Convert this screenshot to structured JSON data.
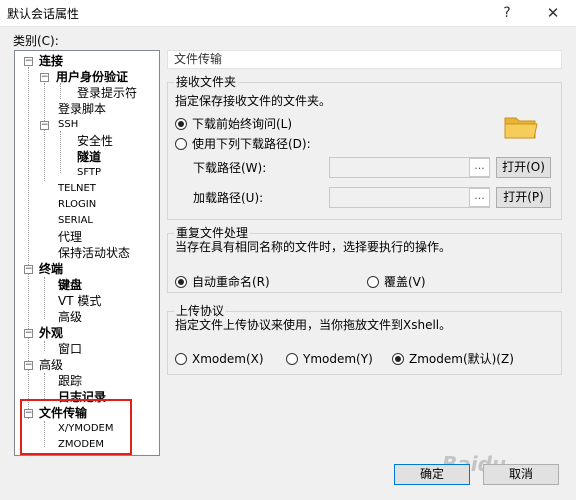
{
  "window": {
    "title": "默认会话属性",
    "help": "?",
    "close": "✕"
  },
  "category_label": "类别(C):",
  "tree": [
    {
      "label": "连接",
      "bold": true,
      "toggle": "⊟"
    },
    {
      "label": "用户身份验证",
      "bold": true,
      "toggle": "⊟"
    },
    {
      "label": "登录提示符"
    },
    {
      "label": "登录脚本"
    },
    {
      "label": "SSH",
      "toggle": "⊟"
    },
    {
      "label": "安全性"
    },
    {
      "label": "隧道",
      "bold": true
    },
    {
      "label": "SFTP"
    },
    {
      "label": "TELNET"
    },
    {
      "label": "RLOGIN"
    },
    {
      "label": "SERIAL"
    },
    {
      "label": "代理"
    },
    {
      "label": "保持活动状态"
    },
    {
      "label": "终端",
      "bold": true,
      "toggle": "⊟"
    },
    {
      "label": "键盘",
      "bold": true
    },
    {
      "label": "VT 模式"
    },
    {
      "label": "高级"
    },
    {
      "label": "外观",
      "bold": true,
      "toggle": "⊟"
    },
    {
      "label": "窗口"
    },
    {
      "label": "高级",
      "toggle": "⊟"
    },
    {
      "label": "跟踪"
    },
    {
      "label": "日志记录",
      "bold": true
    },
    {
      "label": "文件传输",
      "bold": true,
      "toggle": "⊟"
    },
    {
      "label": "X/YMODEM"
    },
    {
      "label": "ZMODEM"
    }
  ],
  "panel": {
    "header": "文件传输",
    "receive": {
      "title": "接收文件夹",
      "desc": "指定保存接收文件的文件夹。",
      "opt_ask": "下载前始终询问(L)",
      "opt_use": "使用下列下载路径(D):",
      "download_label": "下载路径(W):",
      "download_value": "",
      "load_label": "加载路径(U):",
      "load_value": "",
      "dots": "...",
      "open_o": "打开(O)",
      "open_p": "打开(P)"
    },
    "duplicate": {
      "title": "重复文件处理",
      "desc": "当存在具有相同名称的文件时，选择要执行的操作。",
      "opt_rename": "自动重命名(R)",
      "opt_overwrite": "覆盖(V)"
    },
    "upload": {
      "title": "上传协议",
      "desc": "指定文件上传协议来使用，当你拖放文件到Xshell。",
      "opt_x": "Xmodem(X)",
      "opt_y": "Ymodem(Y)",
      "opt_z": "Zmodem(默认)(Z)"
    }
  },
  "buttons": {
    "ok": "确定",
    "cancel": "取消"
  },
  "watermark": "Baidu"
}
